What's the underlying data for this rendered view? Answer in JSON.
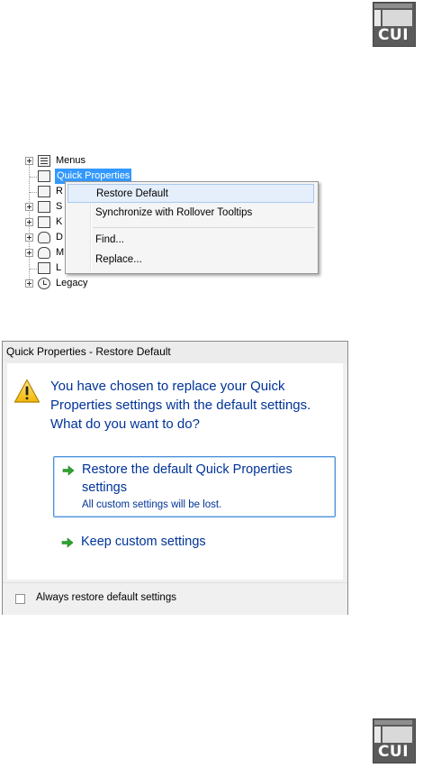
{
  "badge": {
    "label": "CUI"
  },
  "tree": {
    "items": [
      {
        "label": "Menus",
        "icon": "menu-icon",
        "expandable": true
      },
      {
        "label": "Quick Properties",
        "icon": "quick-properties-icon",
        "selected": true
      },
      {
        "label": "R",
        "icon": "rollover-icon"
      },
      {
        "label": "S",
        "icon": "shortcut-icon",
        "expandable": true
      },
      {
        "label": "K",
        "icon": "keyboard-icon",
        "expandable": true
      },
      {
        "label": "D",
        "icon": "double-click-icon",
        "expandable": true
      },
      {
        "label": "M",
        "icon": "mouse-icon",
        "expandable": true
      },
      {
        "label": "L",
        "icon": "lisp-icon"
      },
      {
        "label": "Legacy",
        "icon": "clock-icon",
        "expandable": true
      }
    ]
  },
  "context_menu": {
    "items": [
      {
        "label": "Restore Default",
        "highlighted": true
      },
      {
        "label": "Synchronize with Rollover Tooltips"
      },
      {
        "label": "Find..."
      },
      {
        "label": "Replace..."
      }
    ]
  },
  "dialog": {
    "title": "Quick Properties - Restore Default",
    "main_instruction": "You have chosen to replace your Quick Properties settings with the default settings. What do you want to do?",
    "options": [
      {
        "title": "Restore the default Quick Properties settings",
        "note": "All custom settings will be lost."
      },
      {
        "title": "Keep custom settings"
      }
    ],
    "checkbox_label": "Always restore default settings",
    "checkbox_checked": false
  },
  "colors": {
    "link_blue": "#003399",
    "selection_blue": "#3399ff",
    "arrow_green": "#2fa32f"
  }
}
